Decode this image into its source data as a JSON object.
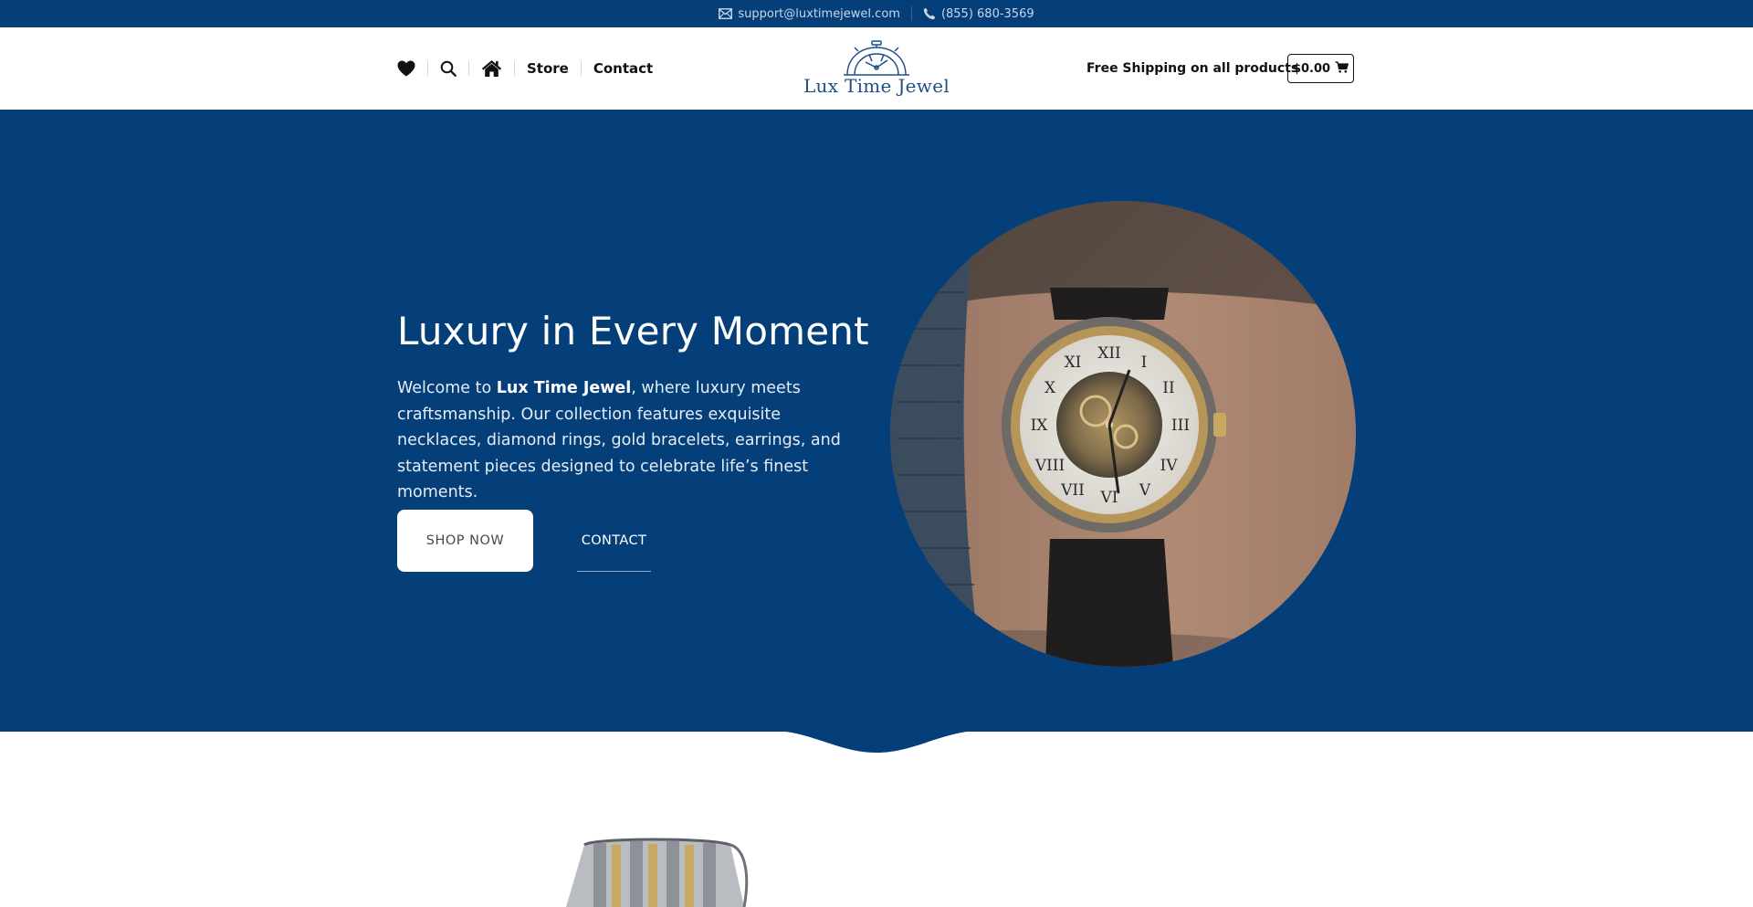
{
  "topbar": {
    "email": "support@luxtimejewel.com",
    "phone": "(855) 680-3569",
    "email_icon": "envelope-icon",
    "phone_icon": "phone-icon"
  },
  "nav": {
    "icons": [
      "heart-icon",
      "search-icon",
      "home-icon"
    ],
    "links": [
      "Store",
      "Contact"
    ]
  },
  "logo": {
    "text": "Lux Time Jewel"
  },
  "header": {
    "shipping_text": "Free Shipping on all products",
    "cart_total": "$0.00",
    "cart_icon": "cart-icon"
  },
  "hero": {
    "title": "Luxury in Every Moment",
    "text_before": "Welcome to ",
    "brand": "Lux Time Jewel",
    "text_after": ", where luxury meets craftsmanship. Our collection features exquisite necklaces, diamond rings, gold bracelets, earrings, and statement pieces designed to celebrate life’s finest moments.",
    "primary_button": "SHOP NOW",
    "secondary_button": "CONTACT"
  },
  "colors": {
    "brand_blue": "#053f7a",
    "logo_blue": "#1d4f86",
    "white": "#ffffff"
  }
}
